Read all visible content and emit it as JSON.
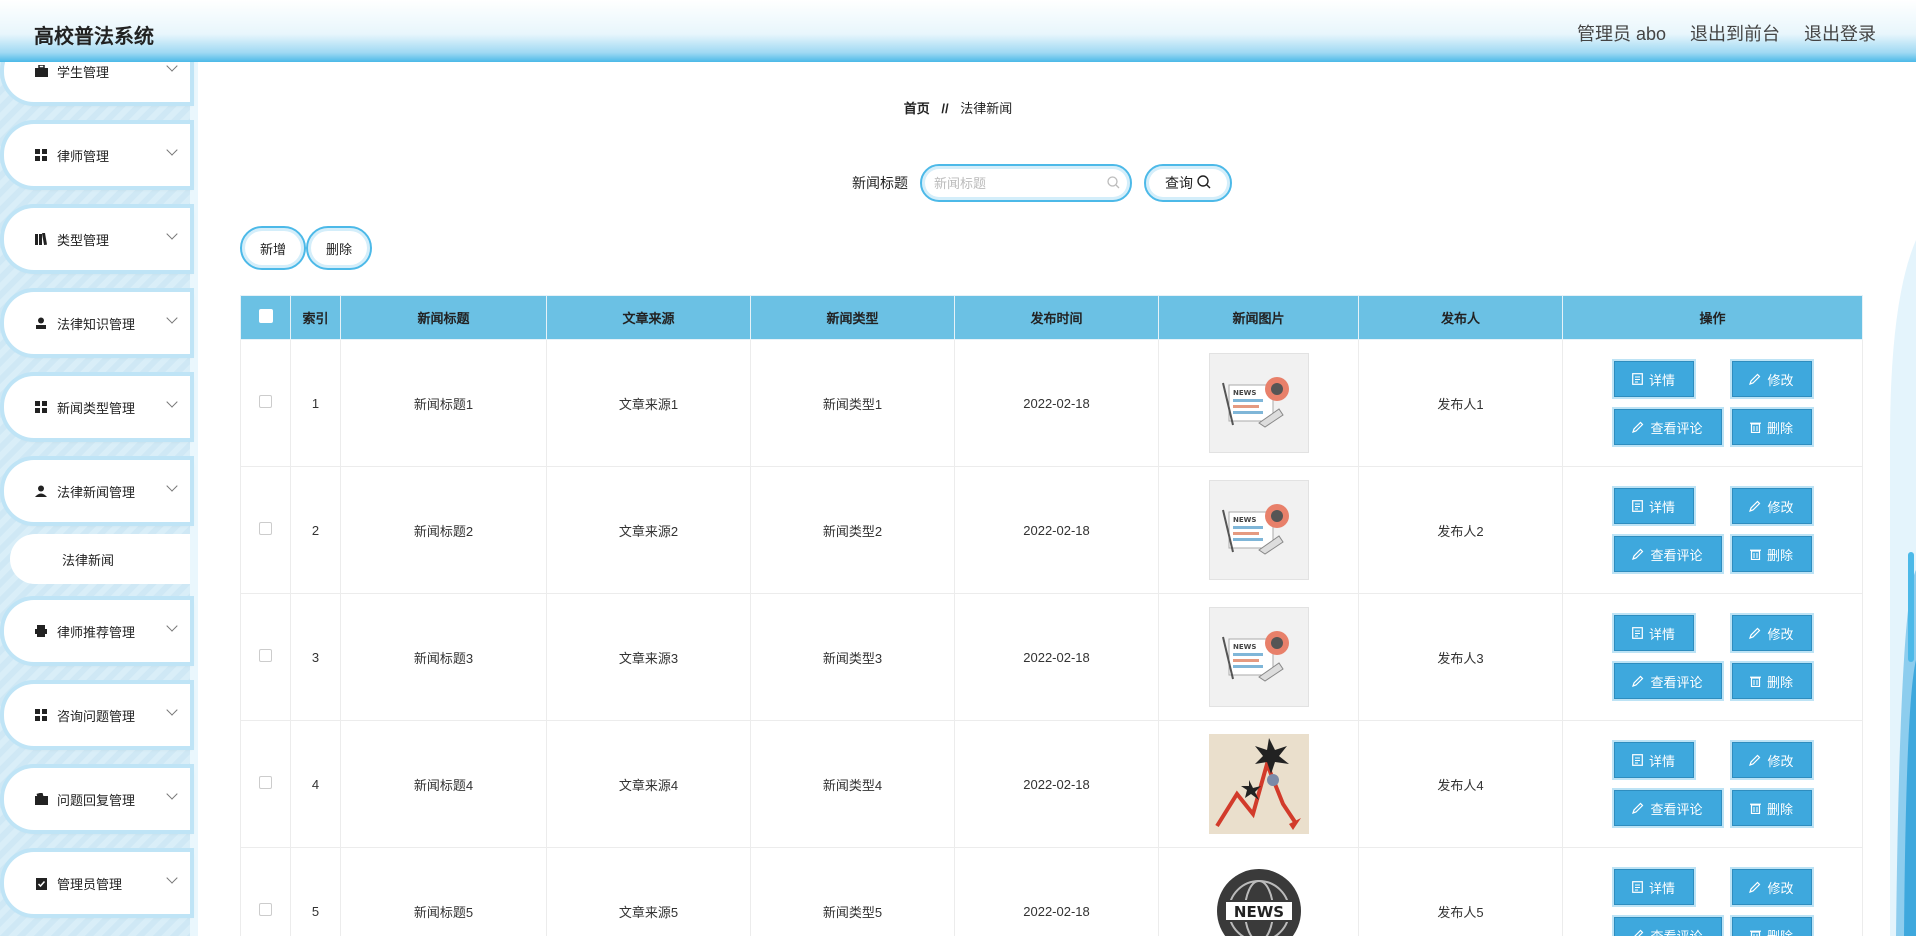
{
  "header": {
    "title": "高校普法系统",
    "user": "管理员 abo",
    "to_front": "退出到前台",
    "logout": "退出登录"
  },
  "sidebar": {
    "items": [
      {
        "label": "学生管理",
        "icon": "briefcase-icon"
      },
      {
        "label": "律师管理",
        "icon": "grid-icon"
      },
      {
        "label": "类型管理",
        "icon": "books-icon"
      },
      {
        "label": "法律知识管理",
        "icon": "user-icon"
      },
      {
        "label": "新闻类型管理",
        "icon": "grid-icon"
      },
      {
        "label": "法律新闻管理",
        "icon": "person-icon"
      },
      {
        "label": "律师推荐管理",
        "icon": "printer-icon"
      },
      {
        "label": "咨询问题管理",
        "icon": "grid-icon"
      },
      {
        "label": "问题回复管理",
        "icon": "wallet-icon"
      },
      {
        "label": "管理员管理",
        "icon": "clipboard-check-icon"
      }
    ],
    "sub_item": "法律新闻"
  },
  "breadcrumb": {
    "home": "首页",
    "sep": "//",
    "current": "法律新闻"
  },
  "search": {
    "label": "新闻标题",
    "placeholder": "新闻标题",
    "button": "查询"
  },
  "actions": {
    "add": "新增",
    "delete": "删除"
  },
  "table": {
    "headers": [
      "索引",
      "新闻标题",
      "文章来源",
      "新闻类型",
      "发布时间",
      "新闻图片",
      "发布人",
      "操作"
    ],
    "rows": [
      {
        "index": "1",
        "title": "新闻标题1",
        "source": "文章来源1",
        "type": "新闻类型1",
        "date": "2022-02-18",
        "image": "news-illustration",
        "author": "发布人1"
      },
      {
        "index": "2",
        "title": "新闻标题2",
        "source": "文章来源2",
        "type": "新闻类型2",
        "date": "2022-02-18",
        "image": "news-illustration",
        "author": "发布人2"
      },
      {
        "index": "3",
        "title": "新闻标题3",
        "source": "文章来源3",
        "type": "新闻类型3",
        "date": "2022-02-18",
        "image": "news-illustration",
        "author": "发布人3"
      },
      {
        "index": "4",
        "title": "新闻标题4",
        "source": "文章来源4",
        "type": "新闻类型4",
        "date": "2022-02-18",
        "image": "falling-chart-illustration",
        "author": "发布人4"
      },
      {
        "index": "5",
        "title": "新闻标题5",
        "source": "文章来源5",
        "type": "新闻类型5",
        "date": "2022-02-18",
        "image": "news-globe-badge",
        "author": "发布人5"
      }
    ],
    "ops": {
      "detail": "详情",
      "edit": "修改",
      "comments": "查看评论",
      "delete": "删除"
    }
  },
  "colors": {
    "accent": "#3ea8dd",
    "header_row": "#6bc1e4",
    "border": "#4cb9e8"
  }
}
